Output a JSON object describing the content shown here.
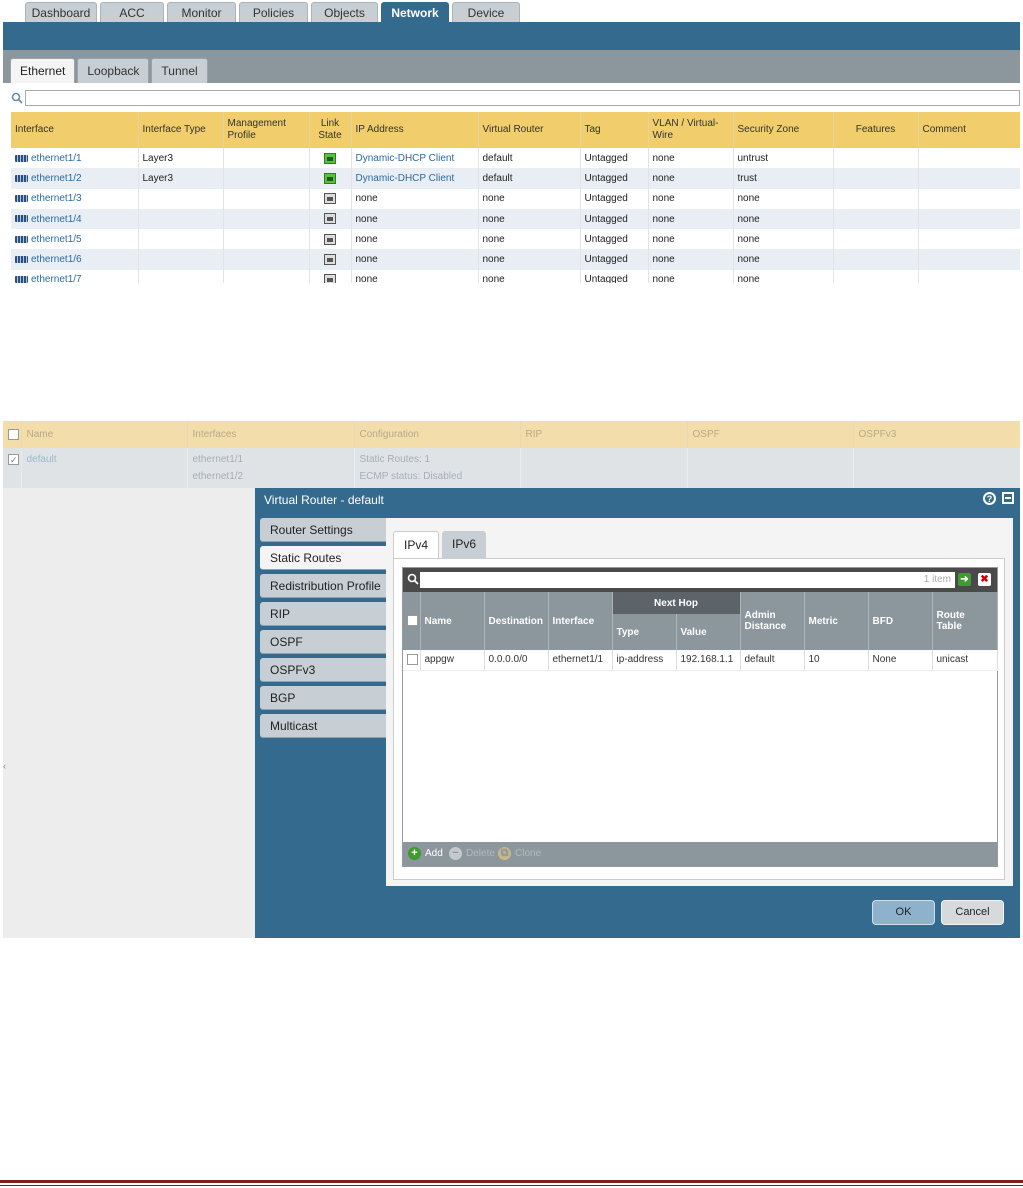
{
  "nav": {
    "tabs": [
      "Dashboard",
      "ACC",
      "Monitor",
      "Policies",
      "Objects",
      "Network",
      "Device"
    ],
    "active": "Network"
  },
  "interfaces": {
    "subtabs": [
      "Ethernet",
      "Loopback",
      "Tunnel"
    ],
    "active_subtab": "Ethernet",
    "filter_value": "",
    "columns": [
      "Interface",
      "Interface Type",
      "Management Profile",
      "Link State",
      "IP Address",
      "Virtual Router",
      "Tag",
      "VLAN / Virtual-Wire",
      "Security Zone",
      "Features",
      "Comment"
    ],
    "rows": [
      {
        "name": "ethernet1/1",
        "type": "Layer3",
        "profile": "",
        "link": "up",
        "ip": "Dynamic-DHCP Client",
        "vr": "default",
        "tag": "Untagged",
        "vlan": "none",
        "zone": "untrust",
        "features": "",
        "comment": ""
      },
      {
        "name": "ethernet1/2",
        "type": "Layer3",
        "profile": "",
        "link": "up",
        "ip": "Dynamic-DHCP Client",
        "vr": "default",
        "tag": "Untagged",
        "vlan": "none",
        "zone": "trust",
        "features": "",
        "comment": ""
      },
      {
        "name": "ethernet1/3",
        "type": "",
        "profile": "",
        "link": "down",
        "ip": "none",
        "vr": "none",
        "tag": "Untagged",
        "vlan": "none",
        "zone": "none",
        "features": "",
        "comment": ""
      },
      {
        "name": "ethernet1/4",
        "type": "",
        "profile": "",
        "link": "down",
        "ip": "none",
        "vr": "none",
        "tag": "Untagged",
        "vlan": "none",
        "zone": "none",
        "features": "",
        "comment": ""
      },
      {
        "name": "ethernet1/5",
        "type": "",
        "profile": "",
        "link": "down",
        "ip": "none",
        "vr": "none",
        "tag": "Untagged",
        "vlan": "none",
        "zone": "none",
        "features": "",
        "comment": ""
      },
      {
        "name": "ethernet1/6",
        "type": "",
        "profile": "",
        "link": "down",
        "ip": "none",
        "vr": "none",
        "tag": "Untagged",
        "vlan": "none",
        "zone": "none",
        "features": "",
        "comment": ""
      },
      {
        "name": "ethernet1/7",
        "type": "",
        "profile": "",
        "link": "down",
        "ip": "none",
        "vr": "none",
        "tag": "Untagged",
        "vlan": "none",
        "zone": "none",
        "features": "",
        "comment": ""
      }
    ]
  },
  "virtual_routers": {
    "columns": [
      "Name",
      "Interfaces",
      "Configuration",
      "RIP",
      "OSPF",
      "OSPFv3"
    ],
    "row": {
      "name": "default",
      "interfaces": [
        "ethernet1/1",
        "ethernet1/2"
      ],
      "configuration": [
        "Static Routes: 1",
        "ECMP status: Disabled"
      ],
      "rip": "",
      "ospf": "",
      "ospfv3": ""
    }
  },
  "dialog": {
    "title": "Virtual Router - default",
    "nav": [
      "Router Settings",
      "Static Routes",
      "Redistribution Profile",
      "RIP",
      "OSPF",
      "OSPFv3",
      "BGP",
      "Multicast"
    ],
    "active_nav": "Static Routes",
    "ip_tabs": [
      "IPv4",
      "IPv6"
    ],
    "active_ip_tab": "IPv4",
    "filter_value": "",
    "item_count": "1 item",
    "group_header": "Next Hop",
    "columns": [
      "Name",
      "Destination",
      "Interface",
      "Type",
      "Value",
      "Admin Distance",
      "Metric",
      "BFD",
      "Route Table"
    ],
    "routes": [
      {
        "name": "appgw",
        "destination": "0.0.0.0/0",
        "interface": "ethernet1/1",
        "type": "ip-address",
        "value": "192.168.1.1",
        "admin_distance": "default",
        "metric": "10",
        "bfd": "None",
        "route_table": "unicast"
      }
    ],
    "footer": {
      "add": "Add",
      "delete": "Delete",
      "clone": "Clone"
    },
    "ok": "OK",
    "cancel": "Cancel"
  },
  "colors": {
    "brand_blue": "#346a8e",
    "header_yellow": "#f1cd6b",
    "link_blue": "#2a6aa0",
    "link_up_green": "#57c242"
  }
}
